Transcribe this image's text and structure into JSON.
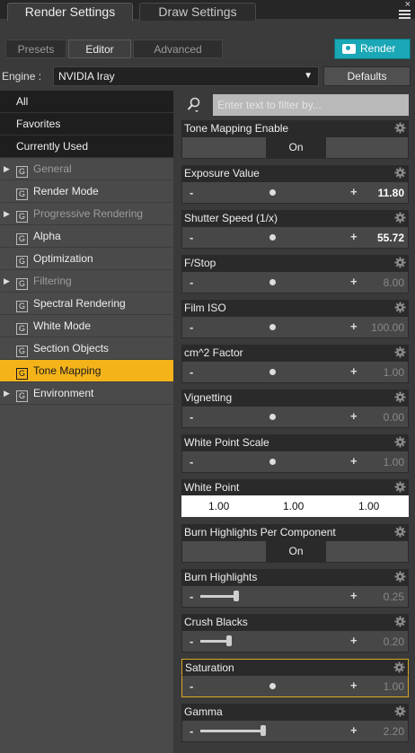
{
  "window": {
    "tabs": [
      "Render Settings",
      "Draw Settings"
    ],
    "close_glyph": "×",
    "menu_icon": "menu-lines-icon"
  },
  "subtabs": [
    "Presets",
    "Editor",
    "Advanced"
  ],
  "render_button": {
    "label": "Render",
    "icon": "camera-icon",
    "color": "#1aa7b6"
  },
  "engine": {
    "label": "Engine :",
    "value": "NVIDIA Iray",
    "arrow": "▼",
    "defaults_label": "Defaults"
  },
  "groups": {
    "all": "All",
    "favorites": "Favorites",
    "currently_used": "Currently Used",
    "items": [
      {
        "label": "General",
        "expandable": true,
        "dim": true
      },
      {
        "label": "Render Mode",
        "expandable": false,
        "dim": false
      },
      {
        "label": "Progressive Rendering",
        "expandable": true,
        "dim": true
      },
      {
        "label": "Alpha",
        "expandable": false,
        "dim": false
      },
      {
        "label": "Optimization",
        "expandable": false,
        "dim": false
      },
      {
        "label": "Filtering",
        "expandable": true,
        "dim": true
      },
      {
        "label": "Spectral Rendering",
        "expandable": false,
        "dim": false
      },
      {
        "label": "White Mode",
        "expandable": false,
        "dim": false
      },
      {
        "label": "Section Objects",
        "expandable": false,
        "dim": false
      },
      {
        "label": "Tone Mapping",
        "expandable": false,
        "dim": false,
        "selected": true
      },
      {
        "label": "Environment",
        "expandable": true,
        "dim": false
      }
    ],
    "group_glyph": "G",
    "expand_glyph": "▶",
    "selected_color": "#f5b31a"
  },
  "filter": {
    "placeholder": "Enter text to filter by..."
  },
  "properties": {
    "tone_mapping_enable": {
      "label": "Tone Mapping Enable",
      "state": "On"
    },
    "exposure_value": {
      "label": "Exposure Value",
      "value": "11.80",
      "knob": 0.5
    },
    "shutter_speed": {
      "label": "Shutter Speed (1/x)",
      "value": "55.72",
      "knob": 0.5
    },
    "f_stop": {
      "label": "F/Stop",
      "value": "8.00",
      "knob": 0.5
    },
    "film_iso": {
      "label": "Film ISO",
      "value": "100.00",
      "knob": 0.5
    },
    "cm2_factor": {
      "label": "cm^2 Factor",
      "value": "1.00",
      "knob": 0.5
    },
    "vignetting": {
      "label": "Vignetting",
      "value": "0.00",
      "knob": 0.5
    },
    "white_point_scale": {
      "label": "White Point Scale",
      "value": "1.00",
      "knob": 0.5
    },
    "white_point": {
      "label": "White Point",
      "r": "1.00",
      "g": "1.00",
      "b": "1.00"
    },
    "burn_highlights_per_component": {
      "label": "Burn Highlights Per Component",
      "state": "On"
    },
    "burn_highlights": {
      "label": "Burn Highlights",
      "value": "0.25",
      "fill": 0.25
    },
    "crush_blacks": {
      "label": "Crush Blacks",
      "value": "0.20",
      "fill": 0.2
    },
    "saturation": {
      "label": "Saturation",
      "value": "1.00",
      "knob": 0.5
    },
    "gamma": {
      "label": "Gamma",
      "value": "2.20",
      "fill": 0.44
    },
    "minus": "-",
    "plus": "+"
  }
}
